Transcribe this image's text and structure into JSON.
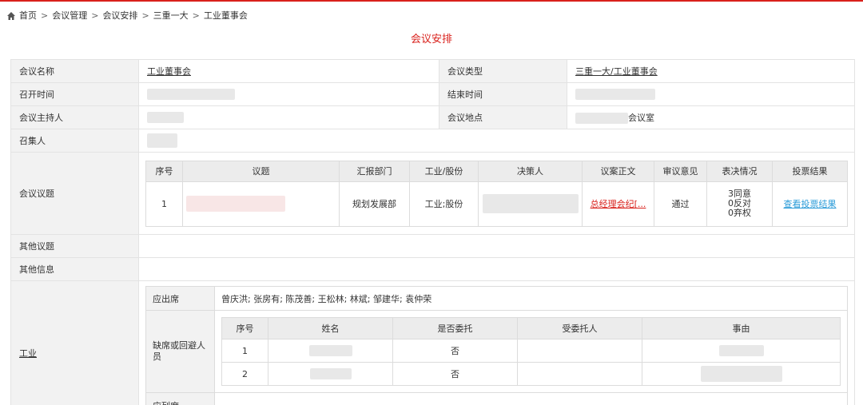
{
  "breadcrumb": {
    "home": "首页",
    "items": [
      "会议管理",
      "会议安排",
      "三重一大",
      "工业董事会"
    ]
  },
  "page_title": "会议安排",
  "info": {
    "name_label": "会议名称",
    "name_value": "工业董事会",
    "type_label": "会议类型",
    "type_value": "三重一大/工业董事会",
    "start_label": "召开时间",
    "end_label": "结束时间",
    "host_label": "会议主持人",
    "location_label": "会议地点",
    "location_suffix": "会议室",
    "convener_label": "召集人",
    "agenda_label": "会议议题",
    "other_agenda_label": "其他议题",
    "other_info_label": "其他信息",
    "industry_label": "工业"
  },
  "agenda": {
    "headers": [
      "序号",
      "议题",
      "汇报部门",
      "工业/股份",
      "决策人",
      "议案正文",
      "审议意见",
      "表决情况",
      "投票结果"
    ],
    "rows": [
      {
        "index": "1",
        "dept": "规划发展部",
        "company": "工业;股份",
        "doc": "总经理会纪[...",
        "opinion": "通过",
        "vote_agree": "3同意",
        "vote_against": "0反对",
        "vote_abstain": "0弃权",
        "result_link": "查看投票结果"
      }
    ]
  },
  "attendance": {
    "required_label": "应出席",
    "required_names": "曾庆洪; 张房有; 陈茂善; 王松林; 林斌; 邹建华; 袁仲荣",
    "absent_label": "缺席或回避人员",
    "absent_headers": [
      "序号",
      "姓名",
      "是否委托",
      "受委托人",
      "事由"
    ],
    "absent_rows": [
      {
        "index": "1",
        "entrusted": "否"
      },
      {
        "index": "2",
        "entrusted": "否"
      }
    ],
    "nonvoting_label": "应列席"
  }
}
